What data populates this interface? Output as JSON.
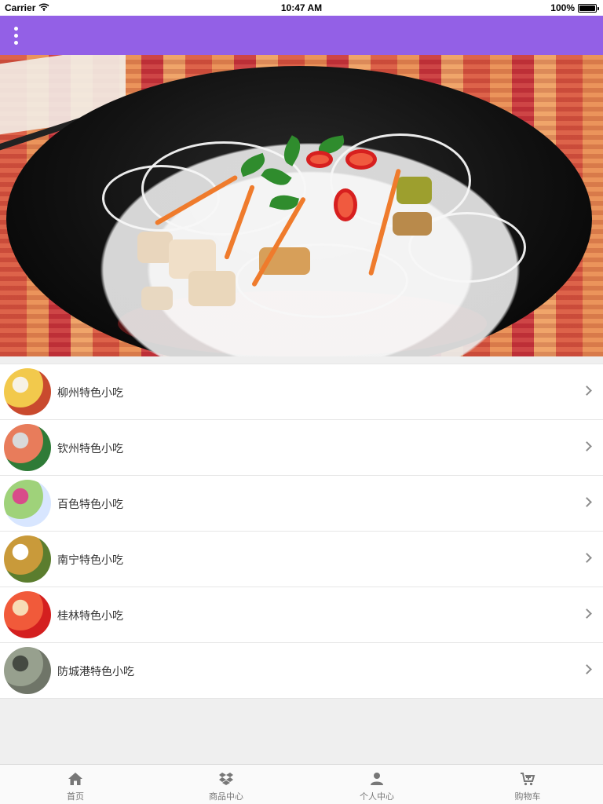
{
  "status_bar": {
    "carrier": "Carrier",
    "time": "10:47 AM",
    "battery": "100%",
    "battery_level": 1.0
  },
  "banner": {
    "page_count": 1,
    "current_page": 1
  },
  "list": {
    "items": [
      {
        "label": "柳州特色小吃",
        "thumb_colors": [
          "#c94a2e",
          "#f2c94c",
          "#f7f2e6"
        ]
      },
      {
        "label": "钦州特色小吃",
        "thumb_colors": [
          "#2f7b37",
          "#e87c5b",
          "#d9d9d9"
        ]
      },
      {
        "label": "百色特色小吃",
        "thumb_colors": [
          "#d8e6ff",
          "#9fd27a",
          "#d84c8a"
        ]
      },
      {
        "label": "南宁特色小吃",
        "thumb_colors": [
          "#5b7d2e",
          "#c99a3a",
          "#ffffff"
        ]
      },
      {
        "label": "桂林特色小吃",
        "thumb_colors": [
          "#d41f1f",
          "#f15a3a",
          "#f7dcb5"
        ]
      },
      {
        "label": "防城港特色小吃",
        "thumb_colors": [
          "#6f7568",
          "#97a08e",
          "#454a42"
        ]
      }
    ]
  },
  "tabs": [
    {
      "label": "首页",
      "icon": "home-icon"
    },
    {
      "label": "商品中心",
      "icon": "dropbox-icon"
    },
    {
      "label": "个人中心",
      "icon": "user-icon"
    },
    {
      "label": "购物车",
      "icon": "cart-icon"
    }
  ],
  "colors": {
    "navbar": "#9360e6",
    "background": "#efefef",
    "tab_text": "#777777",
    "chevron": "#8d8d8d"
  }
}
